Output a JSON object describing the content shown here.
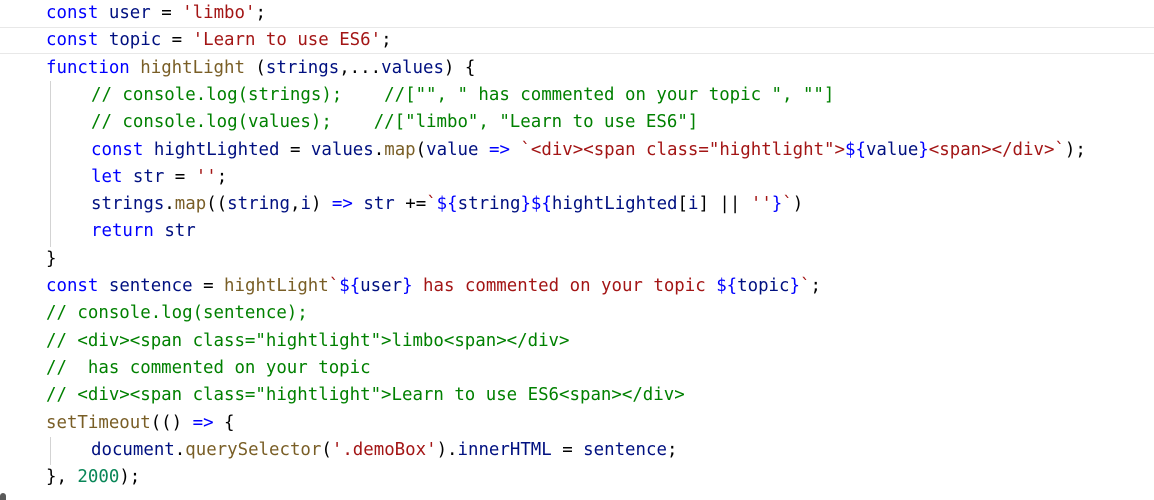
{
  "editor": {
    "language": "javascript",
    "colors": {
      "background": "#ffffff",
      "keyword": "#0000ff",
      "function": "#795e26",
      "string": "#a31515",
      "comment": "#008000",
      "number": "#098658",
      "variable": "#001080",
      "plain": "#000000"
    },
    "lines": [
      {
        "tokens": [
          {
            "t": "kw",
            "v": "const"
          },
          {
            "t": "pl",
            "v": " "
          },
          {
            "t": "var",
            "v": "user"
          },
          {
            "t": "pl",
            "v": " = "
          },
          {
            "t": "str",
            "v": "'limbo'"
          },
          {
            "t": "pl",
            "v": ";"
          }
        ]
      },
      {
        "current": true,
        "tokens": [
          {
            "t": "kw",
            "v": "const"
          },
          {
            "t": "pl",
            "v": " "
          },
          {
            "t": "var",
            "v": "topic"
          },
          {
            "t": "pl",
            "v": " = "
          },
          {
            "t": "str",
            "v": "'Learn to use ES6'"
          },
          {
            "t": "pl",
            "v": ";"
          }
        ]
      },
      {
        "tokens": [
          {
            "t": "kw",
            "v": "function"
          },
          {
            "t": "pl",
            "v": " "
          },
          {
            "t": "fn",
            "v": "hightLight"
          },
          {
            "t": "pl",
            "v": " ("
          },
          {
            "t": "var",
            "v": "strings"
          },
          {
            "t": "pl",
            "v": ",..."
          },
          {
            "t": "var",
            "v": "values"
          },
          {
            "t": "pl",
            "v": ") {"
          }
        ]
      },
      {
        "tokens": [
          {
            "t": "cmt",
            "v": "// console.log(strings);    //[\"\", \" has commented on your topic \", \"\"]"
          }
        ]
      },
      {
        "tokens": [
          {
            "t": "cmt",
            "v": "// console.log(values);    //[\"limbo\", \"Learn to use ES6\"]"
          }
        ]
      },
      {
        "tokens": [
          {
            "t": "kw",
            "v": "const"
          },
          {
            "t": "pl",
            "v": " "
          },
          {
            "t": "var",
            "v": "hightLighted"
          },
          {
            "t": "pl",
            "v": " = "
          },
          {
            "t": "var",
            "v": "values"
          },
          {
            "t": "pl",
            "v": "."
          },
          {
            "t": "fn",
            "v": "map"
          },
          {
            "t": "pl",
            "v": "("
          },
          {
            "t": "var",
            "v": "value"
          },
          {
            "t": "pl",
            "v": " "
          },
          {
            "t": "kw",
            "v": "=>"
          },
          {
            "t": "pl",
            "v": " "
          },
          {
            "t": "str",
            "v": "`<div><span class=\"hightlight\">"
          },
          {
            "t": "kw",
            "v": "${"
          },
          {
            "t": "var",
            "v": "value"
          },
          {
            "t": "kw",
            "v": "}"
          },
          {
            "t": "str",
            "v": "<span></div>`"
          },
          {
            "t": "pl",
            "v": ");"
          }
        ]
      },
      {
        "tokens": [
          {
            "t": "kw",
            "v": "let"
          },
          {
            "t": "pl",
            "v": " "
          },
          {
            "t": "var",
            "v": "str"
          },
          {
            "t": "pl",
            "v": " = "
          },
          {
            "t": "str",
            "v": "''"
          },
          {
            "t": "pl",
            "v": ";"
          }
        ]
      },
      {
        "tokens": [
          {
            "t": "var",
            "v": "strings"
          },
          {
            "t": "pl",
            "v": "."
          },
          {
            "t": "fn",
            "v": "map"
          },
          {
            "t": "pl",
            "v": "(("
          },
          {
            "t": "var",
            "v": "string"
          },
          {
            "t": "pl",
            "v": ","
          },
          {
            "t": "var",
            "v": "i"
          },
          {
            "t": "pl",
            "v": ") "
          },
          {
            "t": "kw",
            "v": "=>"
          },
          {
            "t": "pl",
            "v": " "
          },
          {
            "t": "var",
            "v": "str"
          },
          {
            "t": "pl",
            "v": " +="
          },
          {
            "t": "str",
            "v": "`"
          },
          {
            "t": "kw",
            "v": "${"
          },
          {
            "t": "var",
            "v": "string"
          },
          {
            "t": "kw",
            "v": "}${"
          },
          {
            "t": "var",
            "v": "hightLighted"
          },
          {
            "t": "pl",
            "v": "["
          },
          {
            "t": "var",
            "v": "i"
          },
          {
            "t": "pl",
            "v": "] || "
          },
          {
            "t": "str",
            "v": "''"
          },
          {
            "t": "kw",
            "v": "}"
          },
          {
            "t": "str",
            "v": "`"
          },
          {
            "t": "pl",
            "v": ")"
          }
        ]
      },
      {
        "tokens": [
          {
            "t": "kw",
            "v": "return"
          },
          {
            "t": "pl",
            "v": " "
          },
          {
            "t": "var",
            "v": "str"
          }
        ]
      },
      {
        "tokens": [
          {
            "t": "pl",
            "v": "}"
          }
        ]
      },
      {
        "tokens": [
          {
            "t": "kw",
            "v": "const"
          },
          {
            "t": "pl",
            "v": " "
          },
          {
            "t": "var",
            "v": "sentence"
          },
          {
            "t": "pl",
            "v": " = "
          },
          {
            "t": "fn",
            "v": "hightLight"
          },
          {
            "t": "str",
            "v": "`"
          },
          {
            "t": "kw",
            "v": "${"
          },
          {
            "t": "var",
            "v": "user"
          },
          {
            "t": "kw",
            "v": "}"
          },
          {
            "t": "str",
            "v": " has commented on your topic "
          },
          {
            "t": "kw",
            "v": "${"
          },
          {
            "t": "var",
            "v": "topic"
          },
          {
            "t": "kw",
            "v": "}"
          },
          {
            "t": "str",
            "v": "`"
          },
          {
            "t": "pl",
            "v": ";"
          }
        ]
      },
      {
        "tokens": [
          {
            "t": "cmt",
            "v": "// console.log(sentence);"
          }
        ]
      },
      {
        "tokens": [
          {
            "t": "cmt",
            "v": "// <div><span class=\"hightlight\">limbo<span></div>"
          }
        ]
      },
      {
        "tokens": [
          {
            "t": "cmt",
            "v": "//  has commented on your topic"
          }
        ]
      },
      {
        "tokens": [
          {
            "t": "cmt",
            "v": "// <div><span class=\"hightlight\">Learn to use ES6<span></div>"
          }
        ]
      },
      {
        "tokens": [
          {
            "t": "fn",
            "v": "setTimeout"
          },
          {
            "t": "pl",
            "v": "(() "
          },
          {
            "t": "kw",
            "v": "=>"
          },
          {
            "t": "pl",
            "v": " {"
          }
        ]
      },
      {
        "tokens": [
          {
            "t": "var",
            "v": "document"
          },
          {
            "t": "pl",
            "v": "."
          },
          {
            "t": "fn",
            "v": "querySelector"
          },
          {
            "t": "pl",
            "v": "("
          },
          {
            "t": "str",
            "v": "'.demoBox'"
          },
          {
            "t": "pl",
            "v": ")."
          },
          {
            "t": "var",
            "v": "innerHTML"
          },
          {
            "t": "pl",
            "v": " = "
          },
          {
            "t": "var",
            "v": "sentence"
          },
          {
            "t": "pl",
            "v": ";"
          }
        ]
      },
      {
        "tokens": [
          {
            "t": "pl",
            "v": "}, "
          },
          {
            "t": "num",
            "v": "2000"
          },
          {
            "t": "pl",
            "v": ");"
          }
        ]
      }
    ]
  }
}
